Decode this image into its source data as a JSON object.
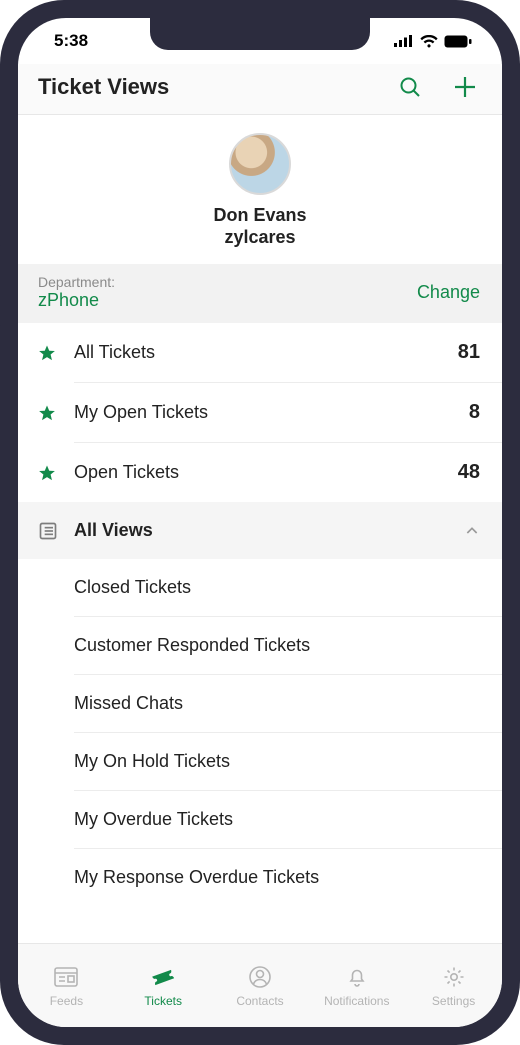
{
  "status": {
    "time": "5:38"
  },
  "header": {
    "title": "Ticket Views"
  },
  "profile": {
    "name": "Don Evans",
    "org": "zylcares"
  },
  "department": {
    "label": "Department:",
    "value": "zPhone",
    "change": "Change"
  },
  "starred": [
    {
      "label": "All Tickets",
      "count": "81"
    },
    {
      "label": "My Open Tickets",
      "count": "8"
    },
    {
      "label": "Open Tickets",
      "count": "48"
    }
  ],
  "allViews": {
    "header": "All Views",
    "items": [
      "Closed Tickets",
      "Customer Responded Tickets",
      "Missed Chats",
      "My On Hold Tickets",
      "My Overdue Tickets",
      "My Response Overdue Tickets"
    ]
  },
  "tabs": [
    {
      "label": "Feeds"
    },
    {
      "label": "Tickets"
    },
    {
      "label": "Contacts"
    },
    {
      "label": "Notifications"
    },
    {
      "label": "Settings"
    }
  ],
  "colors": {
    "accent": "#128a4a"
  }
}
